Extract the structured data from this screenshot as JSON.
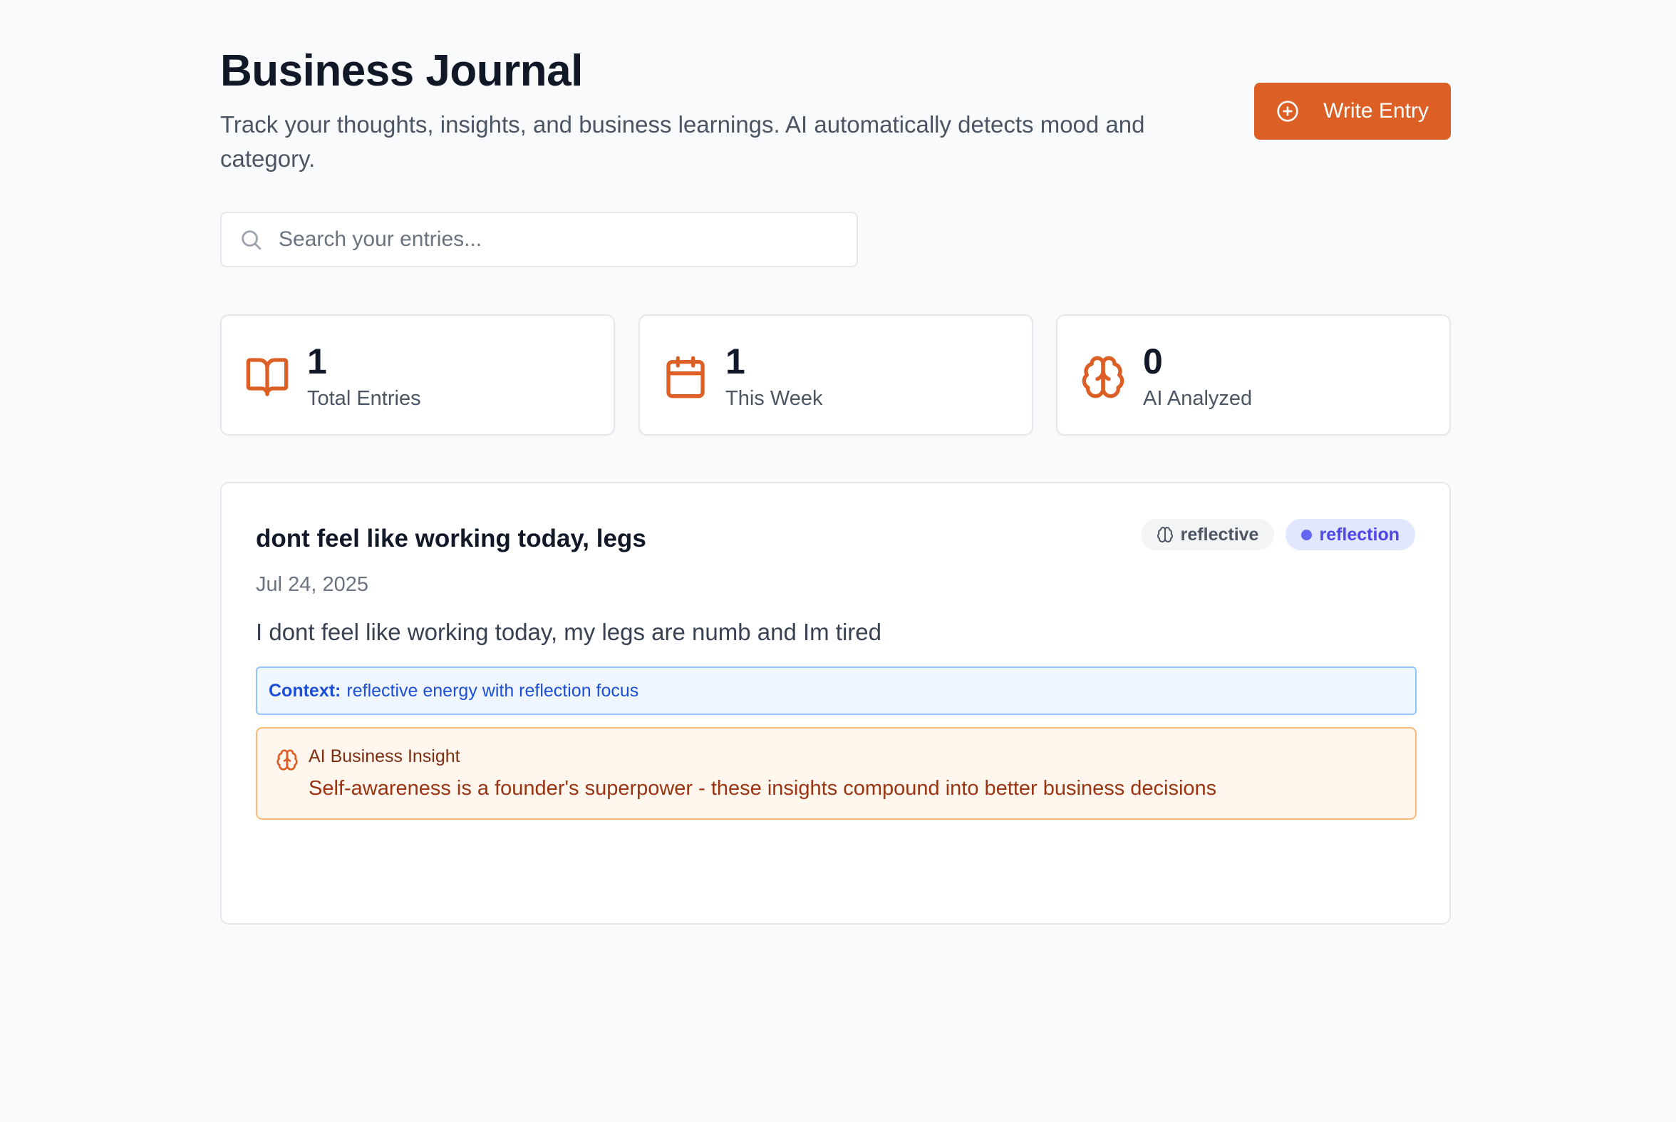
{
  "header": {
    "title": "Business Journal",
    "subtitle": "Track your thoughts, insights, and business learnings. AI automatically detects mood and category.",
    "write_button_label": "Write Entry"
  },
  "search": {
    "placeholder": "Search your entries...",
    "value": ""
  },
  "stats": [
    {
      "value": "1",
      "label": "Total Entries",
      "icon": "book-open-icon"
    },
    {
      "value": "1",
      "label": "This Week",
      "icon": "calendar-icon"
    },
    {
      "value": "0",
      "label": "AI Analyzed",
      "icon": "brain-icon"
    }
  ],
  "entries": [
    {
      "title": "dont feel like working today, legs",
      "date": "Jul 24, 2025",
      "body": "I dont feel like working today, my legs are numb and Im tired",
      "mood_tag": "reflective",
      "category_tag": "reflection",
      "context_label": "Context:",
      "context_text": "reflective energy with reflection focus",
      "insight_title": "AI Business Insight",
      "insight_text": "Self-awareness is a founder's superpower - these insights compound into better business decisions"
    }
  ],
  "colors": {
    "accent": "#dc5f26",
    "background": "#f9fafb",
    "context_bg": "#eff6ff",
    "insight_bg": "#fff7ed",
    "category_tag_bg": "#e0e7ff"
  }
}
